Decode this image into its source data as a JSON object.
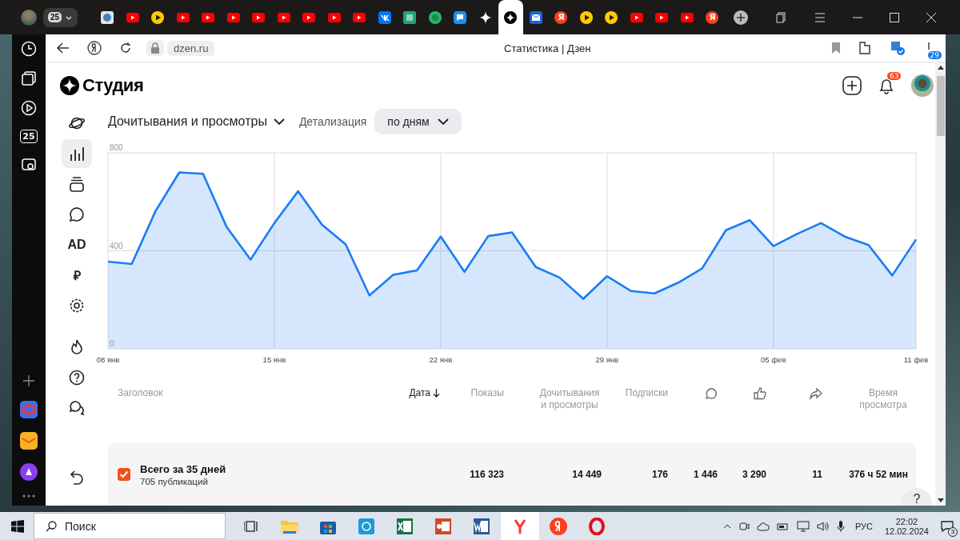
{
  "browser_tabs": {
    "profile_count": "25",
    "tabs": [
      {
        "kind": "site",
        "selected": false
      },
      {
        "kind": "youtube",
        "selected": false
      },
      {
        "kind": "play",
        "selected": false
      },
      {
        "kind": "youtube",
        "selected": false
      },
      {
        "kind": "youtube",
        "selected": false
      },
      {
        "kind": "youtube",
        "selected": false
      },
      {
        "kind": "youtube",
        "selected": false
      },
      {
        "kind": "youtube",
        "selected": false
      },
      {
        "kind": "youtube",
        "selected": false
      },
      {
        "kind": "youtube",
        "selected": false
      },
      {
        "kind": "youtube",
        "selected": false
      },
      {
        "kind": "vk",
        "selected": false
      },
      {
        "kind": "square",
        "selected": false
      },
      {
        "kind": "circle",
        "selected": false
      },
      {
        "kind": "chat",
        "selected": false
      },
      {
        "kind": "sparkle",
        "selected": false
      },
      {
        "kind": "dzen",
        "selected": true
      },
      {
        "kind": "mail",
        "selected": false
      },
      {
        "kind": "ya",
        "label": "Я",
        "selected": false
      },
      {
        "kind": "play",
        "selected": false
      },
      {
        "kind": "play",
        "selected": false
      },
      {
        "kind": "youtube",
        "selected": false
      },
      {
        "kind": "youtube",
        "selected": false
      },
      {
        "kind": "youtube",
        "selected": false
      },
      {
        "kind": "ya",
        "label": "Я",
        "selected": false
      }
    ]
  },
  "side_panel": {
    "calendar": "25"
  },
  "address_bar": {
    "url": "dzen.ru",
    "title": "Статистика | Дзен",
    "downloads_badge": "29"
  },
  "studio": {
    "logo": "Студия",
    "notifications_badge": "63"
  },
  "nav": [
    {
      "kind": "planet",
      "selected": false
    },
    {
      "kind": "chart",
      "selected": true
    },
    {
      "kind": "stack",
      "selected": false
    },
    {
      "kind": "chat",
      "selected": false
    },
    {
      "kind": "text",
      "label": "AD",
      "selected": false
    },
    {
      "kind": "text",
      "label": "₽",
      "selected": false
    },
    {
      "kind": "gear",
      "selected": false
    }
  ],
  "nav_bottom": [
    {
      "kind": "fire"
    },
    {
      "kind": "help"
    },
    {
      "kind": "chats"
    }
  ],
  "filters": {
    "metric": "Дочитывания и просмотры",
    "detail_label": "Детализация",
    "detail_value": "по дням"
  },
  "chart_data": {
    "type": "area",
    "categories": [
      "08 янв",
      null,
      null,
      null,
      null,
      null,
      null,
      "15 янв",
      null,
      null,
      null,
      null,
      null,
      null,
      "22 янв",
      null,
      null,
      null,
      null,
      null,
      null,
      "29 янв",
      null,
      null,
      null,
      null,
      null,
      null,
      "05 фев",
      null,
      null,
      null,
      null,
      null,
      "11 фев"
    ],
    "series": [
      {
        "color": "#1a7cf5",
        "values": [
          356,
          346,
          562,
          720,
          714,
          496,
          364,
          513,
          643,
          507,
          426,
          218,
          302,
          320,
          458,
          314,
          460,
          475,
          334,
          291,
          204,
          296,
          236,
          226,
          270,
          328,
          484,
          525,
          419,
          469,
          513,
          458,
          424,
          299,
          446
        ]
      }
    ],
    "grid": true,
    "ylim": [
      0,
      800
    ],
    "yticks": [
      0,
      400,
      800
    ]
  },
  "table": {
    "columns": [
      {
        "kind": "text",
        "label": "Заголовок",
        "sorted": false
      },
      {
        "kind": "text",
        "label": "Дата",
        "sorted": true
      },
      {
        "kind": "text",
        "label": "Показы",
        "sorted": false
      },
      {
        "kind": "text",
        "label": "Дочитывания и просмотры",
        "sorted": false
      },
      {
        "kind": "text",
        "label": "Подписки",
        "sorted": false
      },
      {
        "kind": "comments",
        "sorted": false
      },
      {
        "kind": "likes",
        "sorted": false
      },
      {
        "kind": "reposts",
        "sorted": false
      },
      {
        "kind": "text",
        "label": "Время просмотра",
        "sorted": false
      }
    ],
    "summary": {
      "checked": true,
      "title": "Всего за 35 дней",
      "subtitle": "705 публикаций",
      "values": [
        "116 323",
        "14 449",
        "176",
        "1 446",
        "3 290",
        "11",
        "376 ч 52 мин"
      ]
    }
  },
  "help_button": "?",
  "taskbar": {
    "search_placeholder": "Поиск",
    "apps": [
      {
        "kind": "taskview"
      },
      {
        "kind": "folder"
      },
      {
        "kind": "store"
      },
      {
        "kind": "globe"
      },
      {
        "kind": "excel"
      },
      {
        "kind": "slides"
      },
      {
        "kind": "word"
      },
      {
        "kind": "ybrowser",
        "selected": true
      },
      {
        "kind": "ya",
        "selected": false
      },
      {
        "kind": "opera",
        "selected": false
      }
    ],
    "language": "РУС",
    "time": "22:02",
    "date": "12.02.2024",
    "notifications": "3"
  }
}
